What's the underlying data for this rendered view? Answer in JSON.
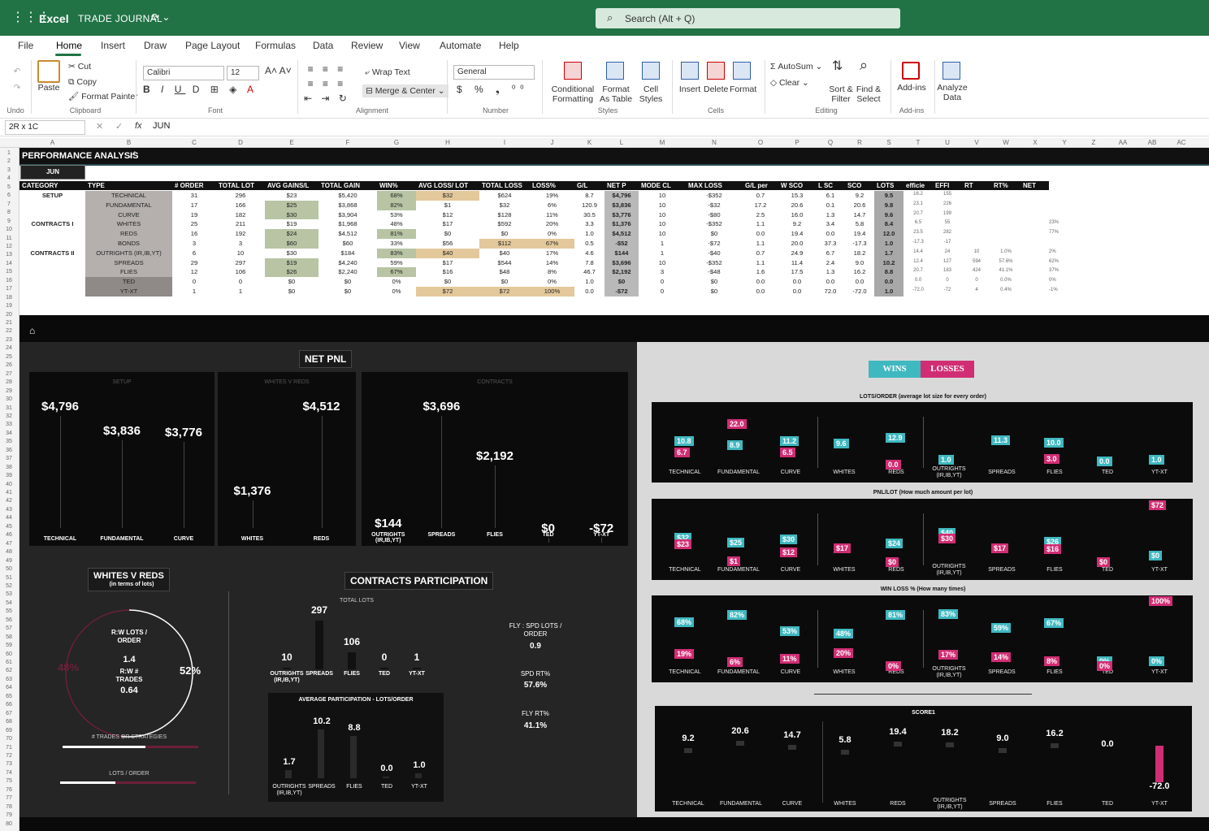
{
  "app": {
    "name": "Excel",
    "doc_title": "TRADE JOURNAL",
    "search_placeholder": "Search (Alt + Q)"
  },
  "menu": [
    "File",
    "Home",
    "Insert",
    "Draw",
    "Page Layout",
    "Formulas",
    "Data",
    "Review",
    "View",
    "Automate",
    "Help"
  ],
  "ribbon": {
    "undo_label": "Undo",
    "paste": "Paste",
    "cut": "Cut",
    "copy": "Copy",
    "format_painter": "Format Painter",
    "clipboard_label": "Clipboard",
    "font_name": "Calibri",
    "font_size": "12",
    "font_label": "Font",
    "wrap_text": "Wrap Text",
    "merge_center": "Merge & Center",
    "alignment_label": "Alignment",
    "number_format": "General",
    "number_label": "Number",
    "cond_format": "Conditional Formatting",
    "format_table": "Format As Table",
    "cell_styles": "Cell Styles",
    "styles_label": "Styles",
    "insert": "Insert",
    "delete": "Delete",
    "format": "Format",
    "cells_label": "Cells",
    "autosum": "AutoSum",
    "clear": "Clear",
    "sort_filter": "Sort & Filter",
    "find_select": "Find & Select",
    "editing_label": "Editing",
    "addins": "Add-ins",
    "addins_label": "Add-ins",
    "analyze": "Analyze Data"
  },
  "formula_bar": {
    "name_box": "2R x 1C",
    "fx": "fx",
    "value": "JUN"
  },
  "columns": [
    "A",
    "B",
    "C",
    "D",
    "E",
    "F",
    "G",
    "H",
    "I",
    "J",
    "K",
    "L",
    "M",
    "N",
    "O",
    "P",
    "Q",
    "R",
    "S",
    "T",
    "U",
    "V",
    "W",
    "X",
    "Y",
    "Z",
    "AA",
    "AB",
    "AC"
  ],
  "sheet": {
    "title": "PERFORMANCE ANALYSIS",
    "month": "JUN",
    "headers": [
      "CATEGORY",
      "TYPE",
      "# ORDER",
      "TOTAL LOT",
      "AVG GAINS/L",
      "TOTAL GAIN",
      "WIN%",
      "AVG LOSS/ LOT",
      "TOTAL LOSS",
      "LOSS%",
      "G/L",
      "NET P",
      "MODE CL",
      "MAX LOSS",
      "G/L per",
      "W SCO",
      "L SC",
      "SCO",
      "LOTS",
      "efficie",
      "EFFI",
      "RT",
      "RT%",
      "NET"
    ],
    "rows": [
      {
        "cat": "SETUP",
        "type": "TECHNICAL",
        "v": [
          "31",
          "296",
          "$23",
          "$5,420",
          "68%",
          "$32",
          "$624",
          "19%",
          "8.7",
          "$4,796",
          "10",
          "-$352",
          "0.7",
          "15.3",
          "6.1",
          "9.2",
          "9.5",
          "16.2",
          "155",
          "",
          "",
          "",
          ""
        ]
      },
      {
        "cat": "",
        "type": "FUNDAMENTAL",
        "v": [
          "17",
          "166",
          "$25",
          "$3,868",
          "82%",
          "$1",
          "$32",
          "6%",
          "120.9",
          "$3,836",
          "10",
          "-$32",
          "17.2",
          "20.6",
          "0.1",
          "20.6",
          "9.8",
          "23.1",
          "226",
          "",
          "",
          "",
          ""
        ]
      },
      {
        "cat": "",
        "type": "CURVE",
        "v": [
          "19",
          "182",
          "$30",
          "$3,904",
          "53%",
          "$12",
          "$128",
          "11%",
          "30.5",
          "$3,776",
          "10",
          "-$80",
          "2.5",
          "16.0",
          "1.3",
          "14.7",
          "9.6",
          "20.7",
          "199",
          "",
          "",
          "",
          ""
        ]
      },
      {
        "cat": "CONTRACTS I",
        "type": "WHITES",
        "v": [
          "25",
          "211",
          "$19",
          "$1,968",
          "48%",
          "$17",
          "$592",
          "20%",
          "3.3",
          "$1,376",
          "10",
          "-$352",
          "1.1",
          "9.2",
          "3.4",
          "5.8",
          "8.4",
          "6.5",
          "55",
          "",
          "",
          "",
          "23%"
        ]
      },
      {
        "cat": "",
        "type": "REDS",
        "v": [
          "16",
          "192",
          "$24",
          "$4,512",
          "81%",
          "$0",
          "$0",
          "0%",
          "1.0",
          "$4,512",
          "10",
          "$0",
          "0.0",
          "19.4",
          "0.0",
          "19.4",
          "12.0",
          "23.5",
          "282",
          "",
          "",
          "",
          "77%"
        ]
      },
      {
        "cat": "",
        "type": "BONDS",
        "v": [
          "3",
          "3",
          "$60",
          "$60",
          "33%",
          "$56",
          "$112",
          "67%",
          "0.5",
          "-$52",
          "1",
          "-$72",
          "1.1",
          "20.0",
          "37.3",
          "-17.3",
          "1.0",
          "-17.3",
          "-17",
          "",
          "",
          "",
          ""
        ]
      },
      {
        "cat": "CONTRACTS II",
        "type": "OUTRIGHTS (IR,IB,YT)",
        "v": [
          "6",
          "10",
          "$30",
          "$184",
          "83%",
          "$40",
          "$40",
          "17%",
          "4.6",
          "$144",
          "1",
          "-$40",
          "0.7",
          "24.9",
          "6.7",
          "18.2",
          "1.7",
          "14.4",
          "24",
          "10",
          "1.0%",
          "",
          "2%"
        ]
      },
      {
        "cat": "",
        "type": "SPREADS",
        "v": [
          "29",
          "297",
          "$19",
          "$4,240",
          "59%",
          "$17",
          "$544",
          "14%",
          "7.8",
          "$3,696",
          "10",
          "-$352",
          "1.1",
          "11.4",
          "2.4",
          "9.0",
          "10.2",
          "12.4",
          "127",
          "594",
          "57.6%",
          "",
          "62%"
        ]
      },
      {
        "cat": "",
        "type": "FLIES",
        "v": [
          "12",
          "106",
          "$26",
          "$2,240",
          "67%",
          "$16",
          "$48",
          "8%",
          "46.7",
          "$2,192",
          "3",
          "-$48",
          "1.6",
          "17.5",
          "1.3",
          "16.2",
          "8.8",
          "20.7",
          "183",
          "424",
          "41.1%",
          "",
          "37%"
        ]
      },
      {
        "cat": "",
        "type": "TED",
        "v": [
          "0",
          "0",
          "$0",
          "$0",
          "0%",
          "$0",
          "$0",
          "0%",
          "1.0",
          "$0",
          "0",
          "$0",
          "0.0",
          "0.0",
          "0.0",
          "0.0",
          "0.0",
          "0.0",
          "0",
          "0",
          "0.0%",
          "",
          "0%"
        ]
      },
      {
        "cat": "",
        "type": "YT-XT",
        "v": [
          "1",
          "1",
          "$0",
          "$0",
          "0%",
          "$72",
          "$72",
          "100%",
          "0.0",
          "-$72",
          "0",
          "$0",
          "0.0",
          "0.0",
          "72.0",
          "-72.0",
          "1.0",
          "-72.0",
          "-72",
          "4",
          "0.4%",
          "",
          "-1%"
        ]
      }
    ]
  },
  "net_pnl": {
    "title": "NET PNL",
    "setup": {
      "sub": "SETUP",
      "items": [
        {
          "label": "TECHNICAL",
          "value": "$4,796"
        },
        {
          "label": "FUNDAMENTAL",
          "value": "$3,836"
        },
        {
          "label": "CURVE",
          "value": "$3,776"
        }
      ]
    },
    "wr": {
      "sub": "WHITES V REDS",
      "items": [
        {
          "label": "WHITES",
          "value": "$1,376"
        },
        {
          "label": "REDS",
          "value": "$4,512"
        }
      ]
    },
    "contracts": {
      "sub": "CONTRACTS",
      "items": [
        {
          "label": "OUTRIGHTS (IR,IB,YT)",
          "value": "$144"
        },
        {
          "label": "SPREADS",
          "value": "$3,696"
        },
        {
          "label": "FLIES",
          "value": "$2,192"
        },
        {
          "label": "TED",
          "value": "$0"
        },
        {
          "label": "YT-XT",
          "value": "-$72"
        }
      ]
    }
  },
  "wvr": {
    "title": "WHITES V REDS",
    "subtitle": "(in terms of lots)",
    "left_pct": "48%",
    "right_pct": "52%",
    "rw_lots_label": "R:W LOTS / ORDER",
    "rw_lots_value": "1.4",
    "rw_trades_label": "R:W # TRADES",
    "rw_trades_value": "0.64",
    "trades_bar_label": "# TRADES OR STRATEGIES",
    "trades_white_frac": 0.61,
    "lots_bar_label": "LOTS / ORDER",
    "lots_white_frac": 0.41
  },
  "participation": {
    "title": "CONTRACTS PARTICIPATION",
    "total_lots_label": "TOTAL LOTS",
    "total_lots": [
      {
        "label": "OUTRIGHTS (IR,IB,YT)",
        "value": "10",
        "n": 10
      },
      {
        "label": "SPREADS",
        "value": "297",
        "n": 297
      },
      {
        "label": "FLIES",
        "value": "106",
        "n": 106
      },
      {
        "label": "TED",
        "value": "0",
        "n": 0
      },
      {
        "label": "YT-XT",
        "value": "1",
        "n": 1
      }
    ],
    "avg_label": "AVERAGE PARTICIPATION - LOTS/ORDER",
    "avg": [
      {
        "label": "OUTRIGHTS (IR,IB,YT)",
        "value": "1.7",
        "n": 1.7
      },
      {
        "label": "SPREADS",
        "value": "10.2",
        "n": 10.2
      },
      {
        "label": "FLIES",
        "value": "8.8",
        "n": 8.8
      },
      {
        "label": "TED",
        "value": "0.0",
        "n": 0
      },
      {
        "label": "YT-XT",
        "value": "1.0",
        "n": 1.0
      }
    ],
    "fly_spd_label": "FLY : SPD LOTS / ORDER",
    "fly_spd": "0.9",
    "spd_rt_label": "SPD RT%",
    "spd_rt": "57.6%",
    "fly_rt_label": "FLY RT%",
    "fly_rt": "41.1%"
  },
  "legend": {
    "wins": "WINS",
    "losses": "LOSSES",
    "wins_color": "#3fb8c0",
    "losses_color": "#d12d74"
  },
  "cats": [
    "TECHNICAL",
    "FUNDAMENTAL",
    "CURVE",
    "WHITES",
    "REDS",
    "OUTRIGHTS (IR,IB,YT)",
    "SPREADS",
    "FLIES",
    "TED",
    "YT-XT"
  ],
  "lots_order": {
    "title": "LOTS/ORDER (average lot size for every order)",
    "wins": [
      "10.8",
      "8.9",
      "11.2",
      "9.6",
      "12.9",
      "1.0",
      "11.3",
      "10.0",
      "0.0",
      "1.0"
    ],
    "losses": [
      "6.7",
      "22.0",
      "6.5",
      "",
      "0.0",
      "",
      "",
      "3.0",
      "",
      ""
    ]
  },
  "pnl_lot": {
    "title": "PNL/LOT (How much amount per lot)",
    "wins": [
      "$32",
      "$25",
      "$30",
      "",
      "$24",
      "$40",
      "",
      "$26",
      "",
      ""
    ],
    "losses": [
      "$23",
      "$1",
      "$12",
      "$17",
      "$0",
      "$30",
      "$17",
      "$16",
      "$0",
      "$72"
    ],
    "extra_win": [
      "",
      "",
      "",
      "",
      "",
      "",
      "",
      "",
      "",
      "$0"
    ]
  },
  "winloss": {
    "title": "WIN LOSS % (How many times)",
    "wins": [
      "68%",
      "82%",
      "53%",
      "48%",
      "81%",
      "83%",
      "59%",
      "67%",
      "0%",
      "0%"
    ],
    "losses": [
      "19%",
      "6%",
      "11%",
      "20%",
      "0%",
      "17%",
      "14%",
      "8%",
      "0%",
      "100%"
    ]
  },
  "score": {
    "title": "SCORE1",
    "values": [
      "9.2",
      "20.6",
      "14.7",
      "5.8",
      "19.4",
      "18.2",
      "9.0",
      "16.2",
      "0.0",
      "-72.0"
    ]
  }
}
